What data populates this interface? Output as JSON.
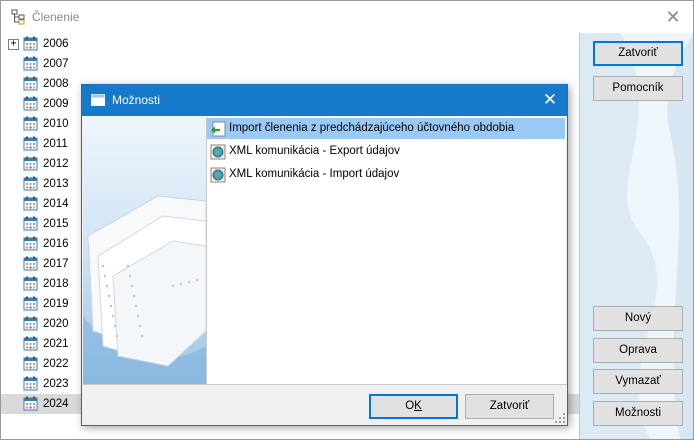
{
  "window": {
    "title": "Členenie",
    "icon": "tree-structure-icon",
    "close_icon": "close-icon"
  },
  "tree": {
    "expander_symbol": "+",
    "icon": "calendar-icon",
    "selected_index": 18,
    "items": [
      {
        "label": "2006"
      },
      {
        "label": "2007"
      },
      {
        "label": "2008"
      },
      {
        "label": "2009"
      },
      {
        "label": "2010"
      },
      {
        "label": "2011"
      },
      {
        "label": "2012"
      },
      {
        "label": "2013"
      },
      {
        "label": "2014"
      },
      {
        "label": "2015"
      },
      {
        "label": "2016"
      },
      {
        "label": "2017"
      },
      {
        "label": "2018"
      },
      {
        "label": "2019"
      },
      {
        "label": "2020"
      },
      {
        "label": "2021"
      },
      {
        "label": "2022"
      },
      {
        "label": "2023"
      },
      {
        "label": "2024"
      }
    ]
  },
  "side_buttons": {
    "close": "Zatvoriť",
    "helper": "Pomocník",
    "new": "Nový",
    "edit": "Oprava",
    "delete": "Vymazať",
    "options": "Možnosti"
  },
  "dialog": {
    "title": "Možnosti",
    "selected_index": 0,
    "items": [
      {
        "label": "Import členenia z predchádzajúceho účtovného obdobia",
        "icon": "import-arrow-icon"
      },
      {
        "label": "XML komunikácia - Export údajov",
        "icon": "globe-document-icon"
      },
      {
        "label": "XML komunikácia - Import údajov",
        "icon": "globe-document-icon"
      }
    ],
    "ok_label": "OK",
    "ok_accesskey": "K",
    "close_label": "Zatvoriť"
  },
  "colors": {
    "dialog_titlebar": "#1679c9",
    "selection": "#99c9f5",
    "side_panel": "#dceaf5"
  }
}
